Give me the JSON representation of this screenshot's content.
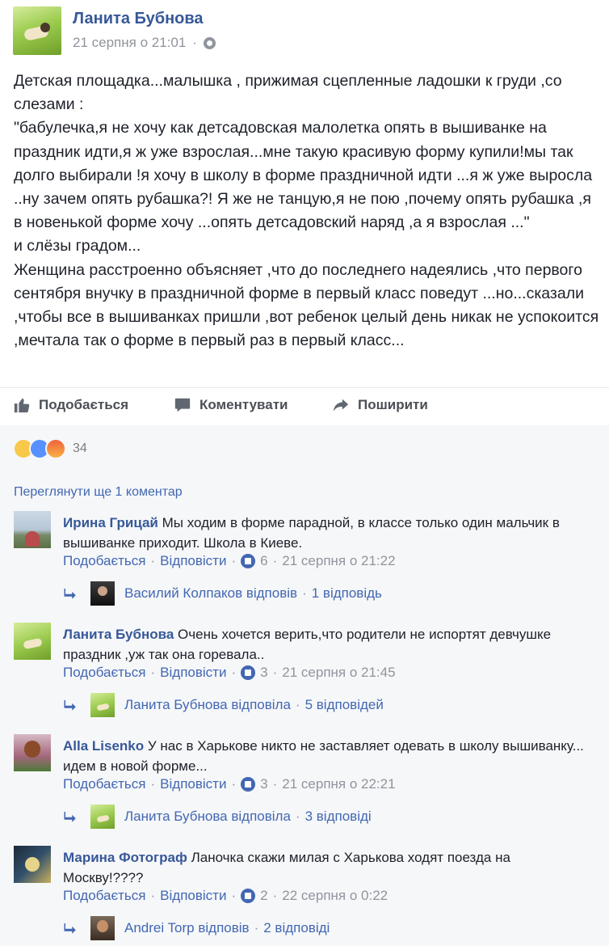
{
  "post": {
    "author": "Ланита Бубнова",
    "timestamp": "21 серпня о 21:01",
    "privacy_icon": "globe-icon",
    "paragraphs": [
      "Детская площадка...малышка , прижимая сцепленные ладошки к груди ,со слезами :",
      "\"бабулечка,я не хочу как детсадовская малолетка опять в вышиванке на праздник идти,я ж уже взрослая...мне такую красивую форму купили!мы так долго выбирали !я хочу в школу в форме праздничной идти ...я ж уже выросла ..ну зачем опять рубашка?! Я же не танцую,я не пою ,почему опять рубашка ,я в новенькой форме хочу ...опять детсадовский наряд ,а я взрослая ...\"",
      "и слёзы градом...",
      "Женщина расстроенно объясняет ,что до последнего надеялись ,что первого сентября внучку в праздничной форме в первый класс поведут ...но...сказали ,чтобы все в вышиванках пришли ,вот ребенок целый день никак не успокоится ,мечтала так о форме в первый раз в первый класс..."
    ]
  },
  "actions": {
    "like": "Подобається",
    "comment": "Коментувати",
    "share": "Поширити"
  },
  "reactions": {
    "icons": [
      "sad-reaction-icon",
      "like-reaction-icon",
      "angry-reaction-icon"
    ],
    "count": "34"
  },
  "view_more": "Переглянути ще 1 коментар",
  "comments": [
    {
      "author": "Ирина Грицай",
      "text": "Мы ходим в форме парадной, в классе только один мальчик в вышиванке приходит. Школа в Киеве.",
      "like_label": "Подобається",
      "reply_label": "Відповісти",
      "likes": "6",
      "time": "21 серпня о 21:22",
      "reply_summary": {
        "author": "Василий Колпаков відповів",
        "count": "1 відповідь"
      }
    },
    {
      "author": "Ланита Бубнова",
      "text": "Очень хочется верить,что родители не испортят девчушке праздник ,уж так она горевала..",
      "like_label": "Подобається",
      "reply_label": "Відповісти",
      "likes": "3",
      "time": "21 серпня о 21:45",
      "reply_summary": {
        "author": "Ланита Бубнова відповіла",
        "count": "5 відповідей"
      }
    },
    {
      "author": "Alla Lisenko",
      "text": "У нас в Харькове никто не заставляет одевать в школу вышиванку... идем в новой форме...",
      "like_label": "Подобається",
      "reply_label": "Відповісти",
      "likes": "3",
      "time": "21 серпня о 22:21",
      "reply_summary": {
        "author": "Ланита Бубнова відповіла",
        "count": "3 відповіді"
      }
    },
    {
      "author": "Марина Фотограф",
      "text": "Ланочка скажи милая с Харькова ходят поезда на Москву!????",
      "like_label": "Подобається",
      "reply_label": "Відповісти",
      "likes": "2",
      "time": "22 серпня о 0:22",
      "reply_summary": {
        "author": "Andrei Torp відповів",
        "count": "2 відповіді"
      }
    }
  ],
  "separator": "·",
  "colors": {
    "link": "#365899",
    "secondary_link": "#4267b2",
    "meta": "#90949c",
    "feedback_bg": "#f6f7f9"
  }
}
